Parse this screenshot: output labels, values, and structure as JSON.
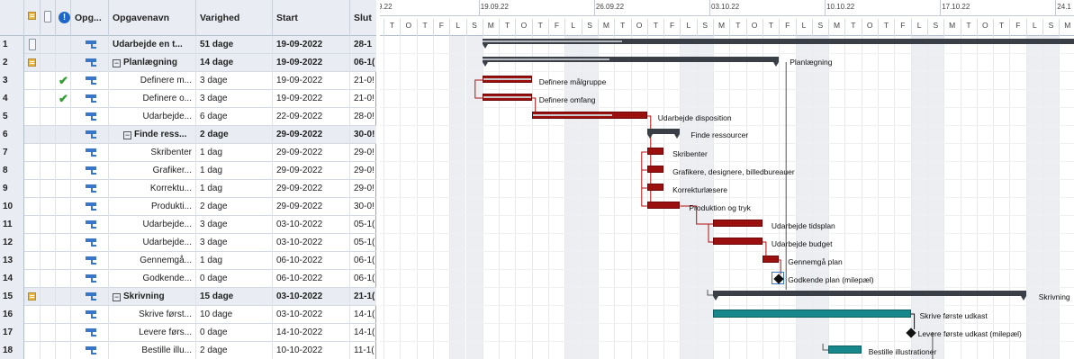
{
  "columns": {
    "mode": "Opg...",
    "name": "Opgavenavn",
    "duration": "Varighed",
    "start": "Start",
    "end": "Slut"
  },
  "timescale": {
    "weeks": [
      "9.22",
      "19.09.22",
      "26.09.22",
      "03.10.22",
      "10.10.22",
      "17.10.22",
      "24.1"
    ],
    "day_letters": [
      "T",
      "O",
      "T",
      "F",
      "L",
      "S",
      "M",
      "T",
      "O",
      "T",
      "F",
      "L",
      "S",
      "M",
      "T",
      "O",
      "T",
      "F",
      "L",
      "S",
      "M",
      "T",
      "O",
      "T",
      "F",
      "L",
      "S",
      "M",
      "T",
      "O",
      "T",
      "F",
      "L",
      "S",
      "M",
      "T",
      "O",
      "T",
      "F",
      "L",
      "S",
      "M"
    ]
  },
  "tasks": [
    {
      "id": "1",
      "name": "Udarbejde en t...",
      "duration": "51 dage",
      "start": "19-09-2022",
      "end": "28-1",
      "summary": true,
      "level": 0,
      "indicator": "paper",
      "done": false
    },
    {
      "id": "2",
      "name": "Planlægning",
      "duration": "14 dage",
      "start": "19-09-2022",
      "end": "06-1(",
      "summary": true,
      "level": 0,
      "indicator": "note",
      "done": false,
      "expander": "⊟"
    },
    {
      "id": "3",
      "name": "Definere m...",
      "duration": "3 dage",
      "start": "19-09-2022",
      "end": "21-0!",
      "summary": false,
      "level": 1,
      "done": true,
      "bar_label": "Definere målgruppe"
    },
    {
      "id": "4",
      "name": "Definere o...",
      "duration": "3 dage",
      "start": "19-09-2022",
      "end": "21-0!",
      "summary": false,
      "level": 1,
      "done": true,
      "bar_label": "Definere omfang"
    },
    {
      "id": "5",
      "name": "Udarbejde...",
      "duration": "6 dage",
      "start": "22-09-2022",
      "end": "28-0!",
      "summary": false,
      "level": 1,
      "done": false,
      "bar_label": "Udarbejde disposition"
    },
    {
      "id": "6",
      "name": "Finde ress...",
      "duration": "2 dage",
      "start": "29-09-2022",
      "end": "30-0!",
      "summary": true,
      "level": 1,
      "done": false,
      "expander": "⊟",
      "bar_label": "Finde ressourcer"
    },
    {
      "id": "7",
      "name": "Skribenter",
      "duration": "1 dag",
      "start": "29-09-2022",
      "end": "29-0!",
      "summary": false,
      "level": 2,
      "done": false,
      "bar_label": "Skribenter"
    },
    {
      "id": "8",
      "name": "Grafiker...",
      "duration": "1 dag",
      "start": "29-09-2022",
      "end": "29-0!",
      "summary": false,
      "level": 2,
      "done": false,
      "bar_label": "Grafikere, designere, billedbureauer"
    },
    {
      "id": "9",
      "name": "Korrektu...",
      "duration": "1 dag",
      "start": "29-09-2022",
      "end": "29-0!",
      "summary": false,
      "level": 2,
      "done": false,
      "bar_label": "Korrekturlæsere"
    },
    {
      "id": "10",
      "name": "Produkti...",
      "duration": "2 dage",
      "start": "29-09-2022",
      "end": "30-0!",
      "summary": false,
      "level": 2,
      "done": false,
      "bar_label": "Produktion og tryk"
    },
    {
      "id": "11",
      "name": "Udarbejde...",
      "duration": "3 dage",
      "start": "03-10-2022",
      "end": "05-1(",
      "summary": false,
      "level": 1,
      "done": false,
      "bar_label": "Udarbejde tidsplan"
    },
    {
      "id": "12",
      "name": "Udarbejde...",
      "duration": "3 dage",
      "start": "03-10-2022",
      "end": "05-1(",
      "summary": false,
      "level": 1,
      "done": false,
      "bar_label": "Udarbejde budget"
    },
    {
      "id": "13",
      "name": "Gennemgå...",
      "duration": "1 dag",
      "start": "06-10-2022",
      "end": "06-1(",
      "summary": false,
      "level": 1,
      "done": false,
      "bar_label": "Gennemgå plan"
    },
    {
      "id": "14",
      "name": "Godkende...",
      "duration": "0 dage",
      "start": "06-10-2022",
      "end": "06-1(",
      "summary": false,
      "level": 1,
      "done": false,
      "bar_label": "Godkende plan (milepæl)"
    },
    {
      "id": "15",
      "name": "Skrivning",
      "duration": "15 dage",
      "start": "03-10-2022",
      "end": "21-1(",
      "summary": true,
      "level": 0,
      "indicator": "note",
      "done": false,
      "expander": "⊟",
      "bar_label": "Skrivning"
    },
    {
      "id": "16",
      "name": "Skrive først...",
      "duration": "10 dage",
      "start": "03-10-2022",
      "end": "14-1(",
      "summary": false,
      "level": 1,
      "done": false,
      "bar_label": "Skrive første udkast"
    },
    {
      "id": "17",
      "name": "Levere førs...",
      "duration": "0 dage",
      "start": "14-10-2022",
      "end": "14-1(",
      "summary": false,
      "level": 1,
      "done": false,
      "bar_label": "Levere første udkast (milepæl)"
    },
    {
      "id": "18",
      "name": "Bestille illu...",
      "duration": "2 dage",
      "start": "10-10-2022",
      "end": "11-1(",
      "summary": false,
      "level": 1,
      "done": false,
      "bar_label": "Bestille illustrationer"
    }
  ],
  "bar_labels": {
    "planlaegning": "Planlægning"
  }
}
